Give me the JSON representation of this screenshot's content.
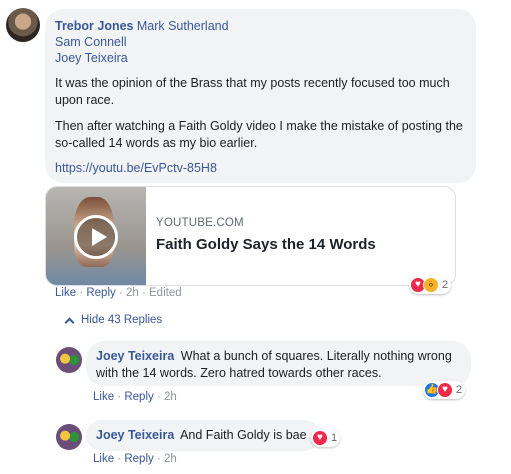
{
  "main_comment": {
    "author": "Trebor Jones",
    "tagged": [
      "Mark Sutherland",
      "Sam Connell",
      "Joey Teixeira"
    ],
    "paragraph_1": "It was the opinion of the Brass that my posts recently focused too much upon race.",
    "paragraph_2": "Then after watching a Faith Goldy video I make the mistake of posting the so-called 14 words as my bio earlier.",
    "link": "https://youtu.be/EvPctv-85H8",
    "preview": {
      "domain": "YOUTUBE.COM",
      "title": "Faith Goldy Says the 14 Words"
    },
    "reactions": {
      "icons": [
        "love-icon",
        "wow-icon"
      ],
      "count": "2"
    },
    "actions": {
      "like": "Like",
      "reply": "Reply",
      "time": "2h",
      "edited": "Edited",
      "sep": "·"
    }
  },
  "hide_replies_label": "Hide 43 Replies",
  "replies": [
    {
      "author": "Joey Teixeira",
      "text": "What a bunch of squares. Literally nothing wrong with the 14 words. Zero hatred towards other races.",
      "reactions": {
        "icons": [
          "like-icon",
          "love-icon"
        ],
        "count": "2"
      },
      "actions": {
        "like": "Like",
        "reply": "Reply",
        "time": "2h"
      }
    },
    {
      "author": "Joey Teixeira",
      "text": "And Faith Goldy is bae",
      "reactions": {
        "icons": [
          "love-icon"
        ],
        "count": "1"
      },
      "actions": {
        "like": "Like",
        "reply": "Reply",
        "time": "2h"
      }
    }
  ],
  "colors": {
    "link": "#385898",
    "bubble": "#f2f3f5",
    "love": "#f0284a",
    "like": "#1877f2",
    "muted": "#90949c"
  }
}
